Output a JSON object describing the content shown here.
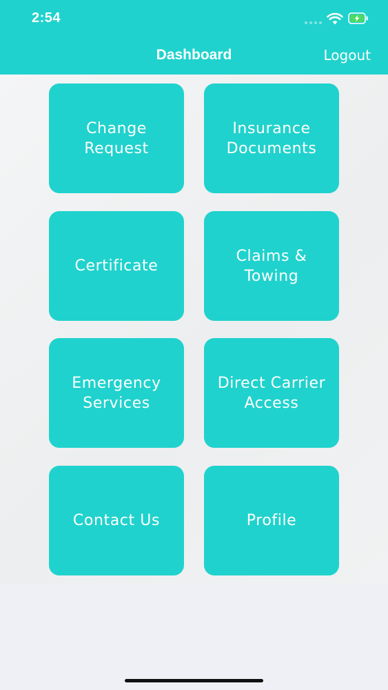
{
  "status_bar": {
    "time": "2:54"
  },
  "nav": {
    "title": "Dashboard",
    "logout_label": "Logout"
  },
  "tiles": [
    {
      "label": "Change\nRequest"
    },
    {
      "label": "Insurance\nDocuments"
    },
    {
      "label": "Certificate"
    },
    {
      "label": "Claims &\nTowing"
    },
    {
      "label": "Emergency\nServices"
    },
    {
      "label": "Direct Carrier\nAccess"
    },
    {
      "label": "Contact Us"
    },
    {
      "label": "Profile"
    }
  ],
  "colors": {
    "accent": "#20d2cd",
    "background": "#eff0f5",
    "text_on_accent": "#ffffff",
    "battery_fill": "#4cd964"
  },
  "icons": {
    "wifi": "wifi-icon",
    "battery": "battery-charging-icon"
  }
}
